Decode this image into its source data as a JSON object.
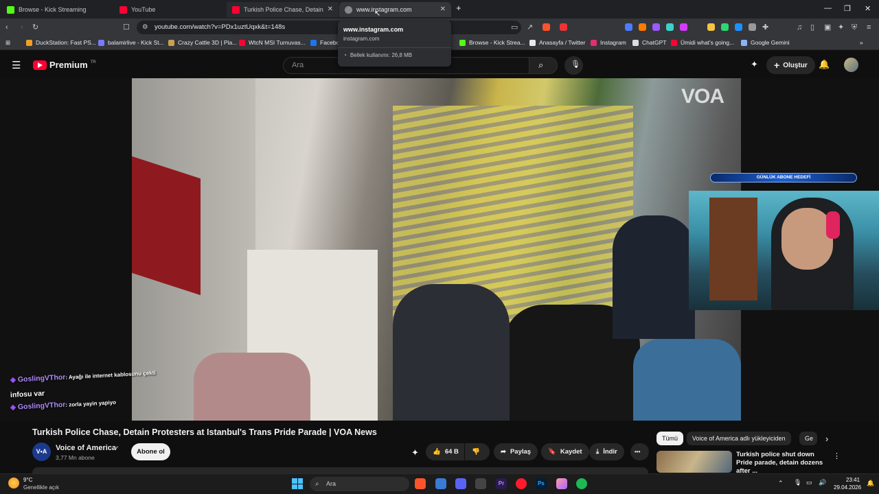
{
  "browser": {
    "tabs": [
      {
        "label": "Browse - Kick Streaming",
        "favicon_color": "#53fc18"
      },
      {
        "label": "YouTube",
        "favicon_color": "#ff0033"
      },
      {
        "label": "Turkish Police Chase, Detain Prot",
        "favicon_color": "#ff0033"
      },
      {
        "label": "www.instagram.com",
        "favicon_color": "#888888"
      }
    ],
    "new_tab": "+",
    "url": "youtube.com/watch?v=PDx1uztUqxk&t=148s",
    "bookmarks": [
      {
        "label": "DuckStation: Fast PS...",
        "color": "#f0a020"
      },
      {
        "label": "balamirlive - Kick St...",
        "color": "#7a7aff"
      },
      {
        "label": "Crazy Cattle 3D | Pla...",
        "color": "#c8a050"
      },
      {
        "label": "WtcN MSI Turnuvas...",
        "color": "#ff0033"
      },
      {
        "label": "Facebo",
        "color": "#1877f2"
      },
      {
        "label": "Browse - Kick Strea...",
        "color": "#53fc18"
      },
      {
        "label": "Anasayfa / Twitter",
        "color": "#e8e8e8"
      },
      {
        "label": "Instagram",
        "color": "#e1306c"
      },
      {
        "label": "ChatGPT",
        "color": "#dddddd"
      },
      {
        "label": "Ümidi what's going...",
        "color": "#ff0033"
      },
      {
        "label": "Google Gemini",
        "color": "#8ab4f8"
      }
    ],
    "tooltip": {
      "title": "www.instagram.com",
      "subtitle": "instagram.com",
      "memory": "Bellek kullanımı: 26,8 MB"
    }
  },
  "youtube": {
    "logo_text": "Premium",
    "logo_sup": "TR",
    "search_placeholder": "Ara",
    "create_label": "Oluştur",
    "video": {
      "watermark": "VOA",
      "sub_goal": "GÜNLÜK ABONE HEDEFİ",
      "chat": [
        {
          "user": "GoslingVThor",
          "text": ": Ayağı ile internet kablosunu çekti"
        },
        {
          "user": "",
          "text": "infosu var"
        },
        {
          "user": "GoslingVThor",
          "text": ": zorla yayin yapiyo"
        }
      ]
    },
    "title": "Turkish Police Chase, Detain Protesters at Istanbul's Trans Pride Parade | VOA News",
    "channel": {
      "name": "Voice of America",
      "avatar_text": "V•A",
      "subs": "3,77 Mn abone"
    },
    "subscribe_label": "Abone ol",
    "actions": {
      "likes": "64 B",
      "share": "Paylaş",
      "save": "Kaydet",
      "download": "İndir",
      "more": "•••"
    },
    "chips": [
      "Tümü",
      "Voice of America adlı yükleyiciden",
      "Ge"
    ],
    "recommended": {
      "title": "Turkish police shut down Pride parade, detain dozens after ..."
    }
  },
  "taskbar": {
    "weather_temp": "9°C",
    "weather_desc": "Genellikle açık",
    "search_placeholder": "Ara",
    "time": "23:41",
    "date": "29.04.2026"
  }
}
